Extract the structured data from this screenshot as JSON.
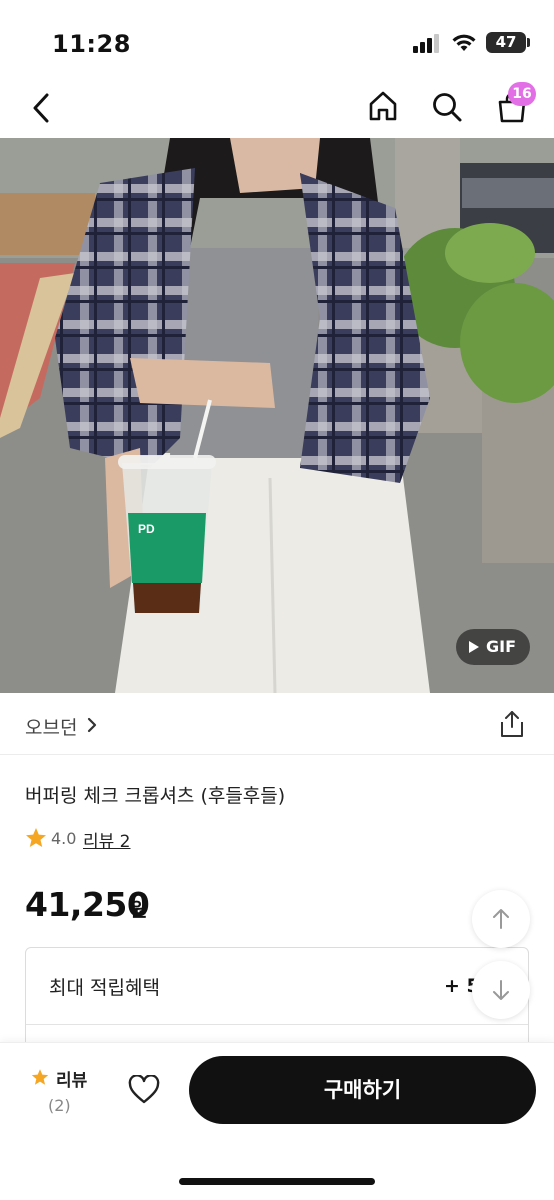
{
  "status_bar": {
    "time": "11:28",
    "battery": "47"
  },
  "nav": {
    "cart_count": "16"
  },
  "hero": {
    "gif_label": "GIF",
    "cup_text": "PD"
  },
  "product": {
    "brand": "오브던",
    "title": "버퍼링 체크 크롭셔츠 (후들후들)",
    "rating": "4.0",
    "review_link": "리뷰 2",
    "price": "41,250",
    "currency": "원"
  },
  "benefit": {
    "label": "최대 적립혜택",
    "value": "+ 5"
  },
  "bottom_bar": {
    "review_label": "리뷰",
    "review_count": "(2)",
    "buy_label": "구매하기"
  },
  "colors": {
    "accent_badge": "#e36fe6",
    "star": "#f5a623",
    "buy_button": "#111111"
  }
}
